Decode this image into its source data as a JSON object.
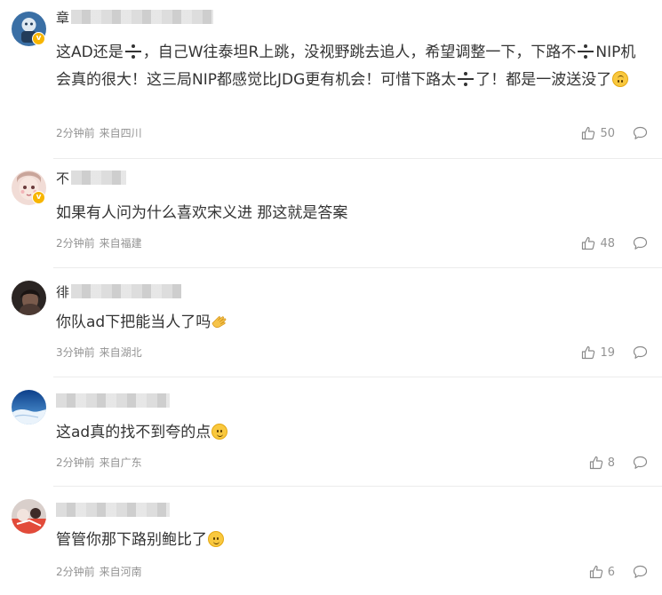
{
  "comments": [
    {
      "username_first_char": "章",
      "verified": true,
      "text_1": "这AD还是",
      "text_2": "，自己W往泰坦R上跳，没视野跳去追人，希望调整一下，下路不",
      "text_3": "NIP机会真的很大！这三局NIP都感觉比JDG更有机会！可惜下路太",
      "text_4": "了！都是一波送没了",
      "time": "2分钟前",
      "location": "来自四川",
      "likes": "50"
    },
    {
      "username_first_char": "不",
      "verified": true,
      "text": "如果有人问为什么喜欢宋义进 那这就是答案",
      "time": "2分钟前",
      "location": "来自福建",
      "likes": "48"
    },
    {
      "username_first_char": "徘",
      "verified": false,
      "text": "你队ad下把能当人了吗",
      "time": "3分钟前",
      "location": "来自湖北",
      "likes": "19"
    },
    {
      "username_first_char": "",
      "verified": false,
      "text": "这ad真的找不到夸的点",
      "time": "2分钟前",
      "location": "来自广东",
      "likes": "8"
    },
    {
      "username_first_char": "",
      "verified": false,
      "text": "管管你那下路别鲍比了",
      "time": "2分钟前",
      "location": "来自河南",
      "likes": "6"
    }
  ],
  "icons": {
    "like": "thumbs-up-icon",
    "reply": "comment-bubble-icon",
    "divide": "divide-sign-emoji",
    "upside_down": "upside-down-face-emoji",
    "clap": "clapping-hands-emoji",
    "smile": "slight-smile-emoji"
  },
  "colors": {
    "text": "#333333",
    "meta": "#939393",
    "divider": "#ececec",
    "verified_badge": "#f7b500"
  }
}
